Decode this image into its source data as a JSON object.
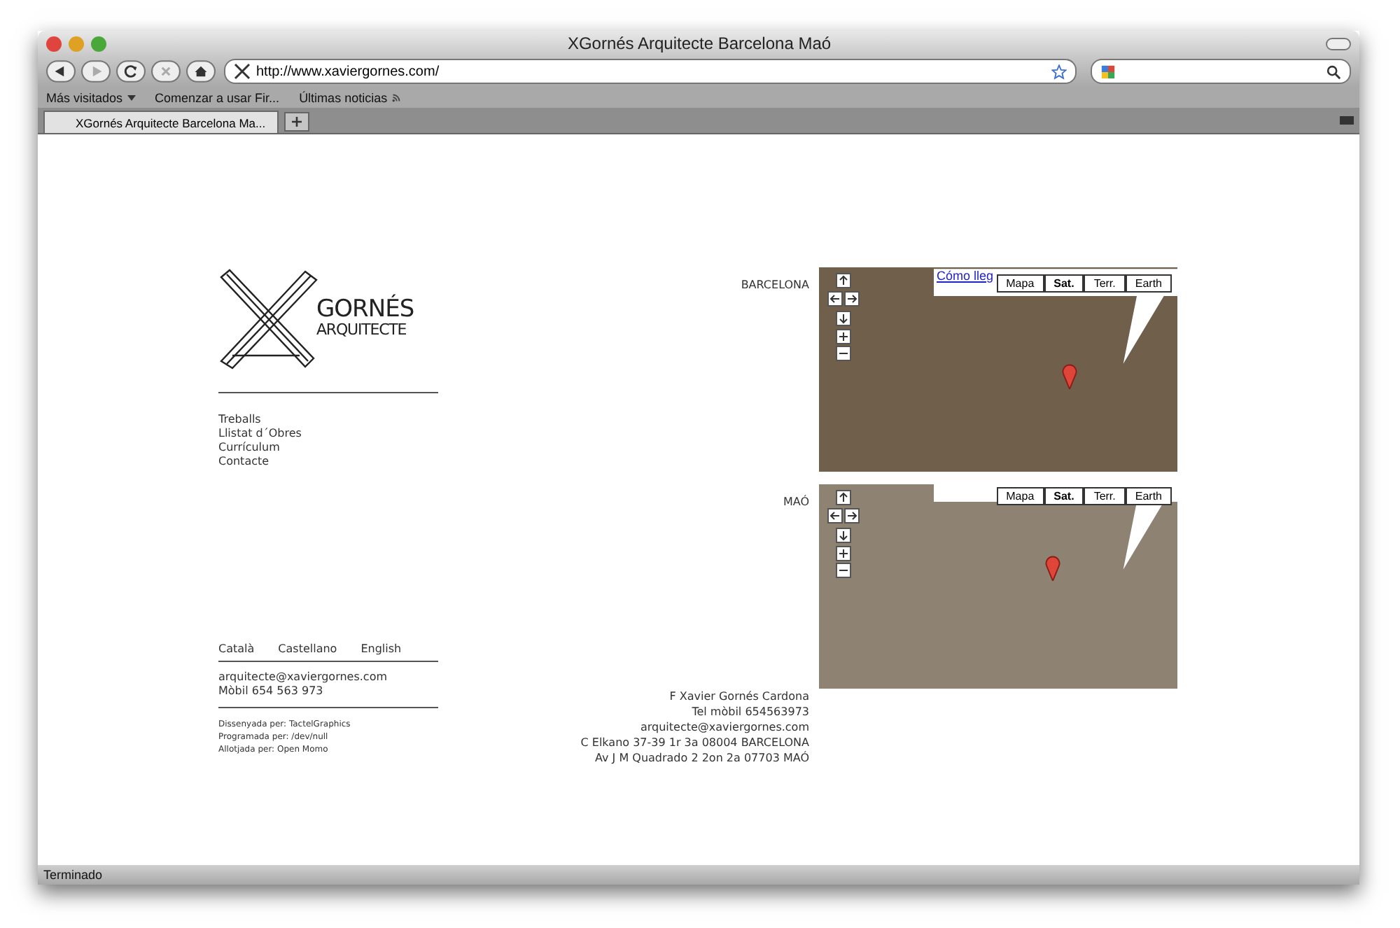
{
  "window": {
    "title": "XGornés Arquitecte Barcelona Maó"
  },
  "toolbar": {
    "url": "http://www.xaviergornes.com/"
  },
  "bookmarks": [
    {
      "label": "Más visitados",
      "kind": "menu"
    },
    {
      "label": "Comenzar a usar Fir...",
      "kind": "link"
    },
    {
      "label": "Últimas noticias",
      "kind": "feed"
    }
  ],
  "tabs": [
    {
      "label": "XGornés Arquitecte Barcelona Ma...",
      "selected": true
    }
  ],
  "site": {
    "logo": {
      "line1": "GORNÉS",
      "line2": "ARQUITECTE"
    },
    "nav": [
      "Treballs",
      "Llistat d´Obres",
      "Currículum",
      "Contacte"
    ],
    "languages": [
      "Català",
      "Castellano",
      "English"
    ],
    "contact": [
      "arquitecte@xaviergornes.com",
      "Mòbil 654 563 973"
    ],
    "credits": [
      "Dissenyada per: TactelGraphics",
      "Programada per: /dev/null",
      "Allotjada per: Open Momo"
    ],
    "maps": [
      {
        "label": "BARCELONA",
        "link": "Cómo lleg",
        "map_types": [
          {
            "label": "Mapa",
            "selected": false
          },
          {
            "label": "Sat.",
            "selected": true
          },
          {
            "label": "Terr.",
            "selected": false
          },
          {
            "label": "Earth",
            "selected": false
          }
        ]
      },
      {
        "label": "MAÓ",
        "map_types": [
          {
            "label": "Mapa",
            "selected": false
          },
          {
            "label": "Sat.",
            "selected": true
          },
          {
            "label": "Terr.",
            "selected": false
          },
          {
            "label": "Earth",
            "selected": false
          }
        ]
      }
    ],
    "address": [
      "F Xavier Gornés Cardona",
      "Tel mòbil 654563973",
      "arquitecte@xaviergornes.com",
      "C Elkano 37-39 1r 3a 08004 BARCELONA",
      "Av J M Quadrado 2 2on 2a 07703 MAÓ"
    ]
  },
  "status_bar": "Terminado"
}
